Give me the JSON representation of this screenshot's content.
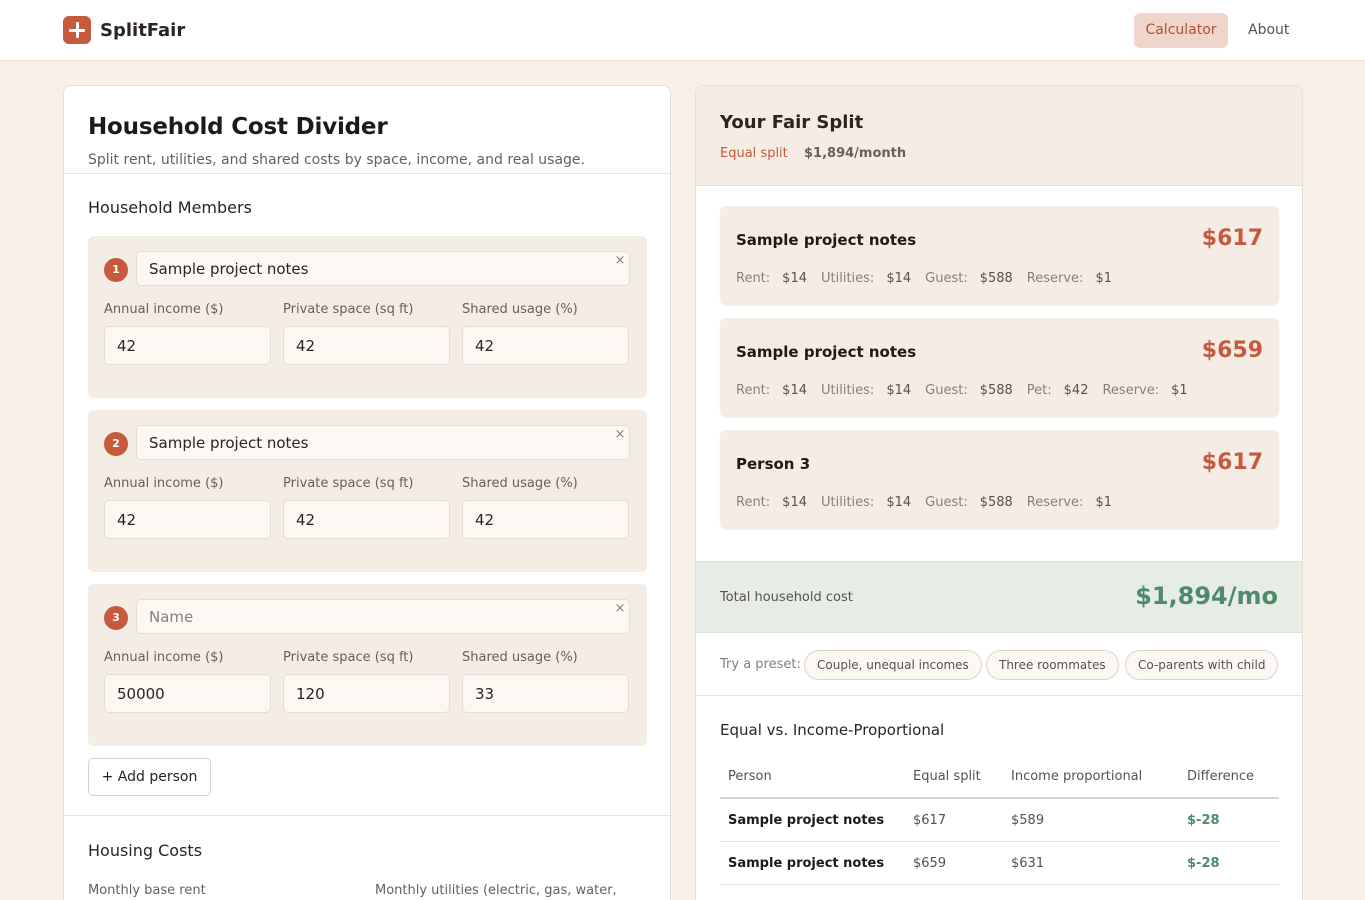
{
  "header": {
    "brand": "SplitFair",
    "nav": {
      "calculator": "Calculator",
      "about": "About"
    }
  },
  "calculator": {
    "title": "Household Cost Divider",
    "subtitle": "Split rent, utilities, and shared costs by space, income, and real usage.",
    "members_title": "Household Members",
    "field_labels": {
      "income": "Annual income ($)",
      "space": "Private space (sq ft)",
      "usage": "Shared usage (%)"
    },
    "members": [
      {
        "number": "1",
        "name": "Sample project notes",
        "income": "42",
        "space": "42",
        "usage": "42"
      },
      {
        "number": "2",
        "name": "Sample project notes",
        "income": "42",
        "space": "42",
        "usage": "42"
      },
      {
        "number": "3",
        "name": "",
        "name_placeholder": "Name",
        "income": "50000",
        "space": "120",
        "usage": "33"
      }
    ],
    "remove_symbol": "×",
    "add_person": "+ Add person",
    "housing_title": "Housing Costs",
    "housing_labels": {
      "rent": "Monthly base rent",
      "utilities": "Monthly utilities (electric, gas, water,"
    }
  },
  "summary": {
    "title": "Your Fair Split",
    "mode": "Equal split",
    "monthly": "$1,894/month",
    "people": [
      {
        "name": "Sample project notes",
        "amount": "$617",
        "breakdown": [
          {
            "label": "Rent:",
            "value": "$14"
          },
          {
            "label": "Utilities:",
            "value": "$14"
          },
          {
            "label": "Guest:",
            "value": "$588"
          },
          {
            "label": "Reserve:",
            "value": "$1"
          }
        ]
      },
      {
        "name": "Sample project notes",
        "amount": "$659",
        "breakdown": [
          {
            "label": "Rent:",
            "value": "$14"
          },
          {
            "label": "Utilities:",
            "value": "$14"
          },
          {
            "label": "Guest:",
            "value": "$588"
          },
          {
            "label": "Pet:",
            "value": "$42"
          },
          {
            "label": "Reserve:",
            "value": "$1"
          }
        ]
      },
      {
        "name": "Person 3",
        "amount": "$617",
        "breakdown": [
          {
            "label": "Rent:",
            "value": "$14"
          },
          {
            "label": "Utilities:",
            "value": "$14"
          },
          {
            "label": "Guest:",
            "value": "$588"
          },
          {
            "label": "Reserve:",
            "value": "$1"
          }
        ]
      }
    ],
    "total_label": "Total household cost",
    "total_value": "$1,894/mo",
    "preset_label": "Try a preset:",
    "presets": [
      "Couple, unequal incomes",
      "Three roommates",
      "Co-parents with child"
    ],
    "comparison": {
      "title": "Equal vs. Income-Proportional",
      "headers": [
        "Person",
        "Equal split",
        "Income proportional",
        "Difference"
      ],
      "rows": [
        [
          "Sample project notes",
          "$617",
          "$589",
          "$-28"
        ],
        [
          "Sample project notes",
          "$659",
          "$631",
          "$-28"
        ]
      ]
    }
  },
  "colors": {
    "accent": "#c65a3c",
    "positive": "#4f8a6a",
    "background": "#f7f1ea",
    "panel": "#f4ede5"
  }
}
